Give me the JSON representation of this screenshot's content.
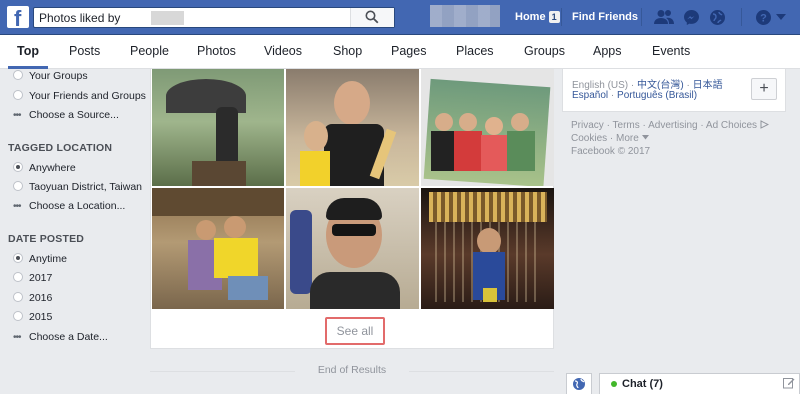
{
  "header": {
    "logo": "f",
    "search_value": "Photos liked by",
    "nav": {
      "home": "Home",
      "home_count": "1",
      "find_friends": "Find Friends"
    },
    "icons": [
      "friends-icon",
      "messenger-icon",
      "globe-icon",
      "help-icon",
      "dropdown-icon"
    ]
  },
  "tabs": [
    "Top",
    "Posts",
    "People",
    "Photos",
    "Videos",
    "Shop",
    "Pages",
    "Places",
    "Groups",
    "Apps",
    "Events"
  ],
  "filters": {
    "source_options": [
      "Your Groups",
      "Your Friends and Groups"
    ],
    "source_choose": "Choose a Source...",
    "location_heading": "TAGGED LOCATION",
    "location_options": [
      "Anywhere",
      "Taoyuan District, Taiwan"
    ],
    "location_choose": "Choose a Location...",
    "date_heading": "DATE POSTED",
    "date_options": [
      "Anytime",
      "2017",
      "2016",
      "2015"
    ],
    "date_choose": "Choose a Date..."
  },
  "results": {
    "see_all": "See all",
    "end_label": "End of Results"
  },
  "languages": {
    "current": "English (US)",
    "links": [
      "中文(台灣)",
      "日本語",
      "Español",
      "Português (Brasil)"
    ]
  },
  "footer": {
    "links_line1": [
      "Privacy",
      "Terms",
      "Advertising",
      "Ad Choices"
    ],
    "links_line2": [
      "Cookies",
      "More"
    ],
    "copyright": "Facebook © 2017"
  },
  "chat": {
    "label": "Chat (7)"
  },
  "colors": {
    "brand": "#4267b2",
    "highlight": "#e26b6b",
    "online": "#42b72a"
  }
}
